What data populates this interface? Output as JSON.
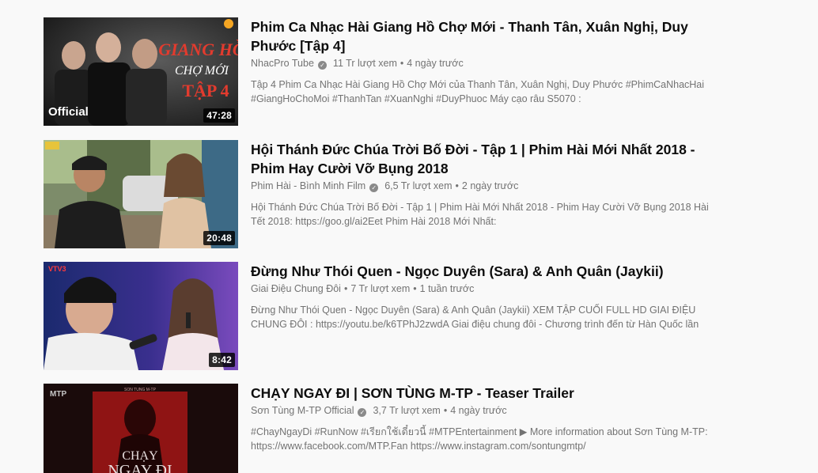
{
  "videos": [
    {
      "title": "Phim Ca Nhạc Hài Giang Hồ Chợ Mới - Thanh Tân, Xuân Nghị, Duy Phước [Tập 4]",
      "channel": "NhacPro Tube",
      "verified": true,
      "views": "11 Tr lượt xem",
      "age": "4 ngày trước",
      "description": "Tập 4 Phim Ca Nhạc Hài Giang Hồ Chợ Mới của Thanh Tân, Xuân Nghị, Duy Phước #PhimCaNhacHai #GiangHoChoMoi #ThanhTan #XuanNghi #DuyPhuoc Máy cạo râu S5070 :",
      "duration": "47:28",
      "thumb_text": {
        "line1": "GIANG HỒ",
        "line2": "CHỢ MỚI",
        "line3": "TẬP 4",
        "badge": "Official"
      }
    },
    {
      "title": "Hội Thánh Đức Chúa Trời Bố Đời - Tập 1 | Phim Hài Mới Nhất 2018 - Phim Hay Cười Vỡ Bụng 2018",
      "channel": "Phim Hài - Bình Minh Film",
      "verified": true,
      "views": "6,5 Tr lượt xem",
      "age": "2 ngày trước",
      "description": "Hội Thánh Đức Chúa Trời Bố Đời - Tập 1 | Phim Hài Mới Nhất 2018 - Phim Hay Cười Vỡ Bụng 2018 Hài Tết 2018: https://goo.gl/ai2Eet Phim Hài 2018 Mới Nhất:",
      "duration": "20:48"
    },
    {
      "title": "Đừng Như Thói Quen - Ngọc Duyên (Sara) & Anh Quân (Jaykii)",
      "channel": "Giai Điệu Chung Đôi",
      "verified": false,
      "views": "7 Tr lượt xem",
      "age": "1 tuần trước",
      "description": "Đừng Như Thói Quen - Ngọc Duyên (Sara) & Anh Quân (Jaykii) XEM TẬP CUỐI FULL HD GIAI ĐIỆU CHUNG ĐÔI : https://youtu.be/k6TPhJ2zwdA Giai điệu chung đôi - Chương trình đến từ Hàn Quốc lần",
      "duration": "8:42"
    },
    {
      "title": "CHẠY NGAY ĐI | SƠN TÙNG M-TP - Teaser Trailer",
      "channel": "Sơn Tùng M-TP Official",
      "verified": true,
      "views": "3,7 Tr lượt xem",
      "age": "4 ngày trước",
      "description": "#ChayNgayDi #RunNow #เรียกใช้เดี๋ยวนี้ #MTPEntertainment ▶ More information about Sơn Tùng M-TP: https://www.facebook.com/MTP.Fan https://www.instagram.com/sontungmtp/",
      "duration": "",
      "thumb_text": {
        "logo": "MTP",
        "small": "SON TUNG M-TP",
        "line1": "CHẠY",
        "line2": "NGAY ĐI"
      }
    }
  ],
  "colors": {
    "background": "#f9f9f9",
    "title": "#0d0d0d",
    "meta": "#737373",
    "duration_bg": "#000000"
  }
}
